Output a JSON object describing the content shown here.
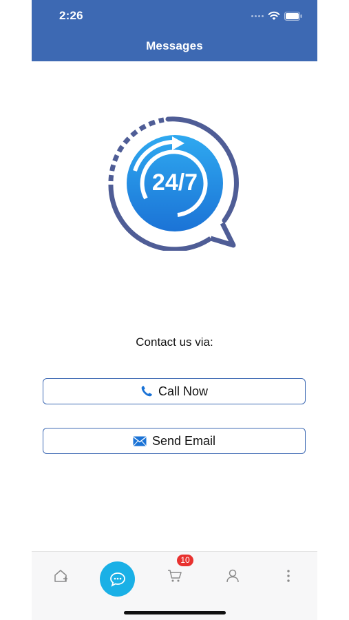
{
  "status_bar": {
    "time": "2:26"
  },
  "header": {
    "title": "Messages"
  },
  "hero": {
    "logo_text": "24/7",
    "icon": "24-7-support-icon"
  },
  "contact": {
    "label": "Contact us via:",
    "call_label": "Call Now",
    "email_label": "Send Email"
  },
  "tab_bar": {
    "items": [
      "home-icon",
      "messages-icon",
      "cart-icon",
      "profile-icon",
      "more-icon"
    ],
    "cart_badge": "10"
  },
  "colors": {
    "header": "#3d69b3",
    "accent": "#1ab0e6",
    "badge": "#e8312f",
    "button_border": "#3d69b3"
  }
}
